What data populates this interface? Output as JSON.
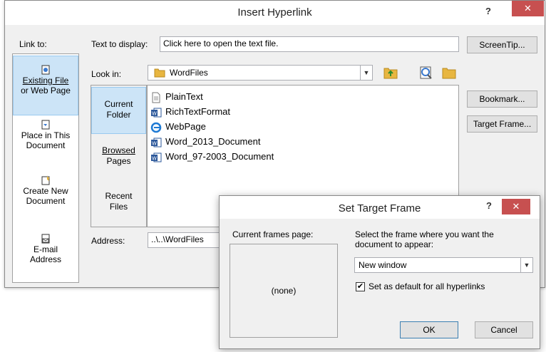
{
  "hyperlink_dialog": {
    "title": "Insert Hyperlink",
    "help": "?",
    "close": "✕",
    "link_to_label": "Link to:",
    "link_to_items": [
      {
        "line1": "Existing File",
        "line2": "or Web Page",
        "icon": "web-page-file-icon"
      },
      {
        "line1": "Place in This",
        "line2": "Document",
        "icon": "place-in-document-icon"
      },
      {
        "line1": "Create New",
        "line2": "Document",
        "icon": "new-document-icon"
      },
      {
        "line1": "E-mail",
        "line2": "Address",
        "icon": "email-icon"
      }
    ],
    "text_to_display_label": "Text to display:",
    "text_to_display_value": "Click here to open the text file.",
    "screentip_button": "ScreenTip...",
    "look_in_label": "Look in:",
    "look_in_value": "WordFiles",
    "look_in_options": [
      {
        "line1": "Current",
        "line2": "Folder"
      },
      {
        "line1": "Browsed",
        "line2": "Pages"
      },
      {
        "line1": "Recent",
        "line2": "Files"
      }
    ],
    "files": [
      {
        "name": "PlainText",
        "icon": "text-file-icon"
      },
      {
        "name": "RichTextFormat",
        "icon": "word-file-icon"
      },
      {
        "name": "WebPage",
        "icon": "internet-explorer-icon"
      },
      {
        "name": "Word_2013_Document",
        "icon": "word-file-icon"
      },
      {
        "name": "Word_97-2003_Document",
        "icon": "word-file-icon"
      }
    ],
    "bookmark_button": "Bookmark...",
    "target_frame_button": "Target Frame...",
    "address_label": "Address:",
    "address_value": "..\\..\\WordFiles"
  },
  "target_frame_dialog": {
    "title": "Set Target Frame",
    "help": "?",
    "close": "✕",
    "current_frames_label": "Current frames page:",
    "frames_preview_value": "(none)",
    "select_frame_label": "Select the frame where you want the document to appear:",
    "frame_value": "New window",
    "default_checkbox_label": "Set as default for all hyperlinks",
    "default_checked": true,
    "ok_button": "OK",
    "cancel_button": "Cancel"
  },
  "colors": {
    "selection_bg": "#cce4f7",
    "close_red": "#c75050",
    "folder_yellow": "#e8b640",
    "word_blue": "#2b579a"
  }
}
